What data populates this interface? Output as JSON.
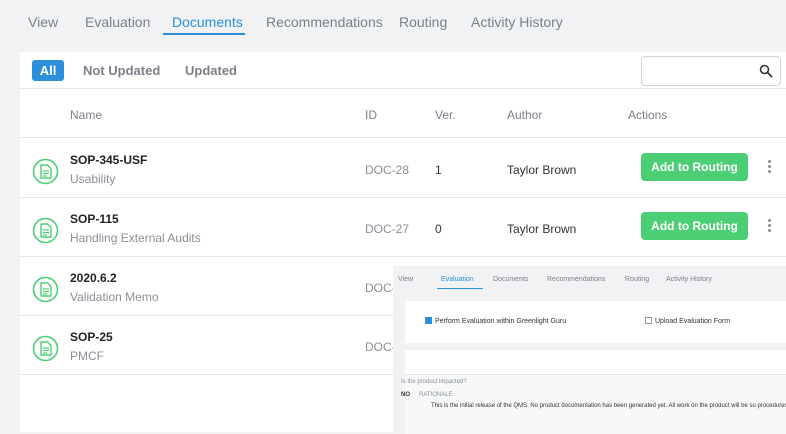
{
  "tabs": [
    "View",
    "Evaluation",
    "Documents",
    "Recommendations",
    "Routing",
    "Activity History"
  ],
  "active_tab": "Documents",
  "filters": [
    "All",
    "Not Updated",
    "Updated"
  ],
  "search": {
    "placeholder": "",
    "value": ""
  },
  "columns": {
    "name": "Name",
    "id": "ID",
    "ver": "Ver.",
    "author": "Author",
    "actions": "Actions"
  },
  "rows": [
    {
      "name": "SOP-345-USF",
      "desc": "Usability",
      "id": "DOC-28",
      "ver": "1",
      "author": "Taylor Brown",
      "action": "Add to Routing"
    },
    {
      "name": "SOP-115",
      "desc": "Handling External Audits",
      "id": "DOC-27",
      "ver": "0",
      "author": "Taylor Brown",
      "action": "Add to Routing"
    },
    {
      "name": "2020.6.2",
      "desc": "Validation Memo",
      "id": "DOC-",
      "ver": "",
      "author": "",
      "action": ""
    },
    {
      "name": "SOP-25",
      "desc": "PMCF",
      "id": "DOC-",
      "ver": "",
      "author": "",
      "action": ""
    }
  ],
  "overlay": {
    "tabs": [
      "View",
      "Evaluation",
      "Documents",
      "Recommendations",
      "Routing",
      "Activity History"
    ],
    "active_tab": "Evaluation",
    "checkbox_1": "Perform Evaluation within Greenlight Guru",
    "checkbox_1_checked": true,
    "checkbox_2": "Upload Evaluation Form",
    "checkbox_2_checked": false,
    "question": "Is the product impacted?",
    "answer": "NO",
    "rationale_label": "RATIONALE",
    "rationale_text": "This is the initial release of the QMS. No product documentation has been generated yet. All work on the product will be su procedures."
  },
  "colors": {
    "accent": "#2b8fd9",
    "success": "#4ccf74",
    "icon": "#4ccf74"
  },
  "icons": {
    "search": "search-icon",
    "document": "document-icon",
    "more": "kebab-menu-icon"
  }
}
